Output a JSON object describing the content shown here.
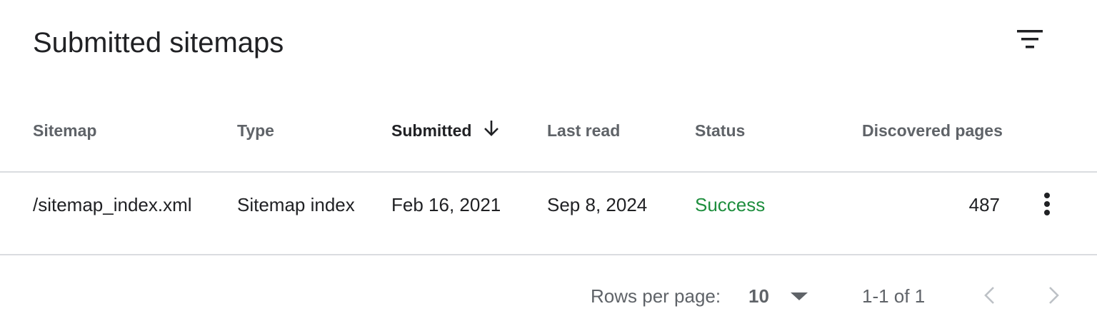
{
  "card": {
    "title": "Submitted sitemaps",
    "filter_icon": "filter-list-icon"
  },
  "table": {
    "columns": [
      {
        "label": "Sitemap"
      },
      {
        "label": "Type"
      },
      {
        "label": "Submitted",
        "sorted": "descending"
      },
      {
        "label": "Last read"
      },
      {
        "label": "Status"
      },
      {
        "label": "Discovered pages"
      }
    ],
    "rows": [
      {
        "sitemap": "/sitemap_index.xml",
        "type": "Sitemap index",
        "submitted": "Feb 16, 2021",
        "last_read": "Sep 8, 2024",
        "status": "Success",
        "discovered_pages": "487",
        "menu_icon": "more-vert-icon"
      }
    ]
  },
  "pagination": {
    "rows_per_page_label": "Rows per page:",
    "rows_per_page_value": "10",
    "range_text": "1-1 of 1",
    "prev_icon": "chevron-left-icon",
    "next_icon": "chevron-right-icon"
  },
  "colors": {
    "status_success": "#1e8e3e",
    "divider": "#dadce0",
    "secondary_text": "#5f6368",
    "primary_text": "#202124"
  }
}
